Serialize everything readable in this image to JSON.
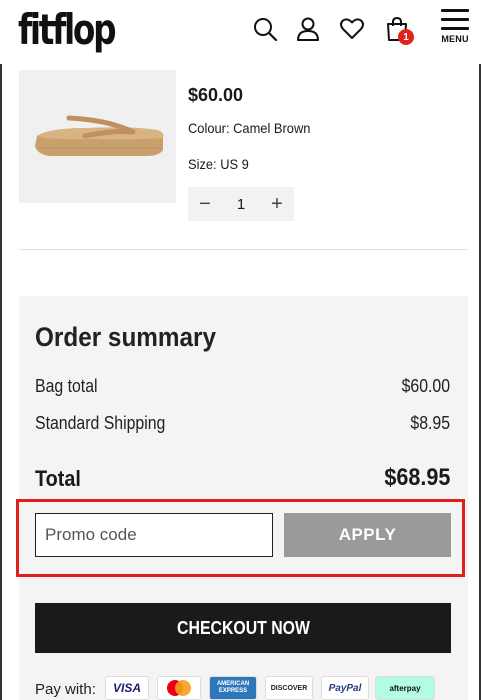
{
  "brand": {
    "logo_text": "fitflop"
  },
  "header": {
    "icons": [
      "search-icon",
      "account-icon",
      "heart-icon",
      "bag-icon"
    ],
    "bag_count": "1",
    "menu_label": "MENU"
  },
  "product": {
    "price": "$60.00",
    "colour": "Colour: Camel Brown",
    "size": "Size: US 9",
    "quantity": "1",
    "minus": "−",
    "plus": "+"
  },
  "summary": {
    "title": "Order summary",
    "rows": [
      {
        "label": "Bag total",
        "value": "$60.00"
      },
      {
        "label": "Standard Shipping",
        "value": "$8.95"
      }
    ],
    "total_label": "Total",
    "total_value": "$68.95",
    "promo_placeholder": "Promo code",
    "apply_label": "APPLY",
    "checkout_label": "CHECKOUT NOW",
    "pay_with_label": "Pay with:",
    "payment_methods": [
      "VISA",
      "mastercard",
      "AMERICAN EXPRESS",
      "DISCOVER",
      "PayPal",
      "afterpay"
    ]
  },
  "colors": {
    "accent": "#e2231a",
    "highlight_border": "#e0201c",
    "checkout_bg": "#1a1a1a",
    "apply_bg": "#9a9a9a"
  }
}
